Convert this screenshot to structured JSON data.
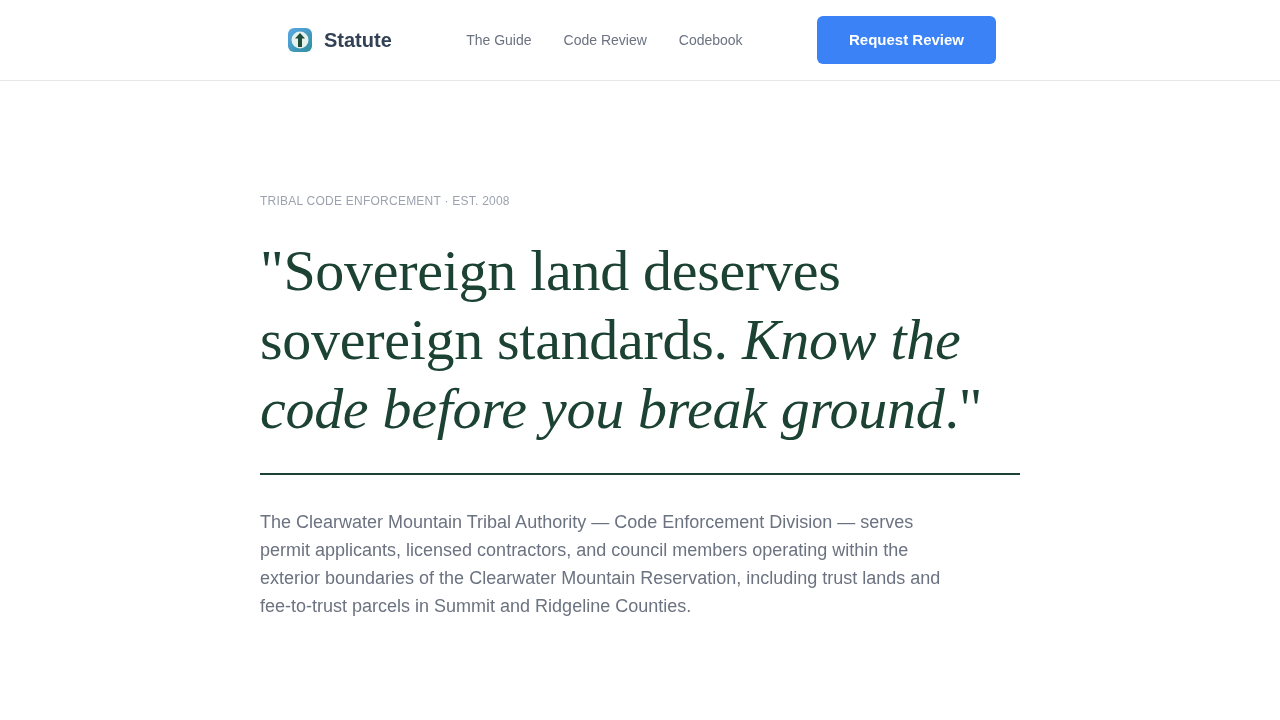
{
  "header": {
    "brand": "Statute",
    "nav": [
      "The Guide",
      "Code Review",
      "Codebook"
    ],
    "cta": "Request Review"
  },
  "hero": {
    "eyebrow": "TRIBAL CODE ENFORCEMENT · EST. 2008",
    "headline": "\"Sovereign land deserves sovereign standards. *Know the code before you break ground*.\"",
    "body": "The Clearwater Mountain Tribal Authority — Code Enforcement Division — serves permit applicants, licensed contractors, and council members operating within the exterior boundaries of the Clearwater Mountain Reservation, including trust lands and fee-to-trust parcels in Summit and Ridgeline Counties."
  }
}
